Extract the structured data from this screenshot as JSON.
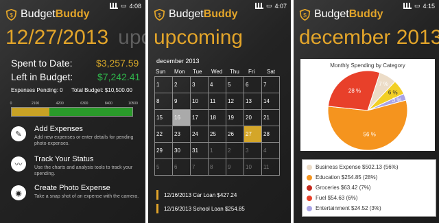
{
  "brand": {
    "part1": "Budget",
    "part2": "Buddy"
  },
  "accent": "#e3a52a",
  "panel1": {
    "time": "4:08",
    "pivot_current": "12/27/2013",
    "pivot_next": "upc",
    "spent_label": "Spent to Date:",
    "spent_value": "$3,257.59",
    "spent_color": "#d4a629",
    "left_label": "Left in Budget:",
    "left_value": "$7,242.41",
    "left_color": "#2fb34a",
    "pending_label": "Expenses Pending: 0",
    "total_label": "Total Budget: $10,500.00",
    "bar": {
      "ticks": [
        "0",
        "2100",
        "4200",
        "6300",
        "8400",
        "10500"
      ],
      "spent_fraction": 0.31,
      "left_fraction": 0.69
    },
    "actions": [
      {
        "icon": "clipboard-icon",
        "glyph": "✎",
        "title": "Add Expenses",
        "desc": "Add new expenses or enter details for pending photo expenses."
      },
      {
        "icon": "chart-icon",
        "glyph": "〰",
        "title": "Track Your Status",
        "desc": "Use the charts and analysis tools to track your spending."
      },
      {
        "icon": "camera-icon",
        "glyph": "◉",
        "title": "Create Photo Expense",
        "desc": "Take a snap shot of an expense with the camera."
      }
    ]
  },
  "panel2": {
    "time": "4:07",
    "pivot_current": "upcoming",
    "month": "december 2013",
    "weekdays": [
      "Sun",
      "Mon",
      "Tue",
      "Wed",
      "Thu",
      "Fri",
      "Sat"
    ],
    "weeks": [
      [
        "1",
        "2",
        "3",
        "4",
        "5",
        "6",
        "7"
      ],
      [
        "8",
        "9",
        "10",
        "11",
        "12",
        "13",
        "14"
      ],
      [
        "15",
        "16",
        "17",
        "18",
        "19",
        "20",
        "21"
      ],
      [
        "22",
        "23",
        "24",
        "25",
        "26",
        "27",
        "28"
      ],
      [
        "29",
        "30",
        "31",
        "1",
        "2",
        "3",
        "4"
      ],
      [
        "5",
        "6",
        "7",
        "8",
        "9",
        "10",
        "11"
      ]
    ],
    "bills": [
      {
        "text": "12/16/2013  Car Loan  $427.24"
      },
      {
        "text": "12/16/2013  School Loan  $254.85"
      }
    ]
  },
  "panel3": {
    "time": "4:15",
    "pivot_current": "december 2013",
    "chart_title": "Monthly Spending by Category"
  },
  "chart_data": {
    "type": "pie",
    "title": "Monthly Spending by Category",
    "slices": [
      {
        "name": "Business Expense",
        "value": 502.13,
        "pct": 56,
        "label": "56 %",
        "color": "#f5941e"
      },
      {
        "name": "Education",
        "value": 254.85,
        "pct": 28,
        "label": "28 %",
        "color": "#e8402a"
      },
      {
        "name": "Groceries",
        "value": 63.42,
        "pct": 7,
        "label": "7 %",
        "color": "#ecdcc7"
      },
      {
        "name": "Fuel",
        "value": 54.63,
        "pct": 6,
        "label": "6 %",
        "color": "#f2cf25"
      },
      {
        "name": "Entertainment",
        "value": 24.52,
        "pct": 3,
        "label": "3 %",
        "color": "#a9a4e6"
      }
    ],
    "legend": [
      {
        "text": "Business Expense $502.13 (56%)",
        "color": "#ecdcc7"
      },
      {
        "text": "Education $254.85 (28%)",
        "color": "#f5941e"
      },
      {
        "text": "Groceries $63.42 (7%)",
        "color": "#c42a1e"
      },
      {
        "text": "Fuel $54.63 (6%)",
        "color": "#e8402a"
      },
      {
        "text": "Entertainment $24.52 (3%)",
        "color": "#a9a4e6"
      }
    ]
  }
}
